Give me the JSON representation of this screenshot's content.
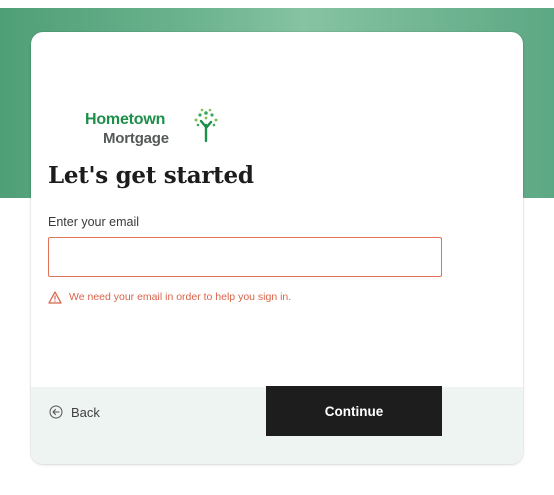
{
  "brand": {
    "name_line1": "Hometown",
    "name_line2": "Mortgage",
    "logo_icon": "tree-icon",
    "primary_color": "#1e8f4a",
    "secondary_color": "#555a57"
  },
  "form": {
    "heading": "Let's get started",
    "email_label": "Enter your email",
    "email_value": "",
    "email_placeholder": "",
    "error_message": "We need your email in order to help you sign in.",
    "error_icon": "warning-triangle-icon",
    "error_color": "#d9634a"
  },
  "footer": {
    "back_label": "Back",
    "back_icon": "arrow-left-circle-icon",
    "continue_label": "Continue",
    "continue_bg": "#1d1d1d"
  },
  "theme": {
    "band_color": "#6cb38f",
    "footer_bg": "#eef4f2"
  }
}
